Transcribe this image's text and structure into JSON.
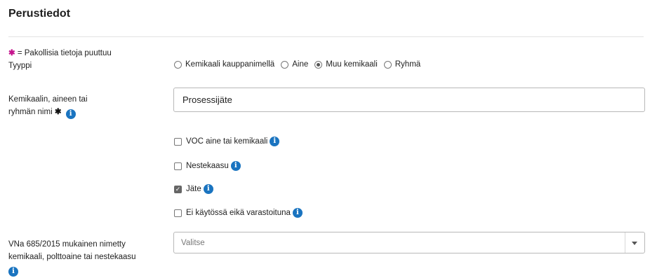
{
  "section": {
    "title": "Perustiedot"
  },
  "required_note": {
    "star": "✱",
    "text": "= Pakollisia tietoja puuttuu"
  },
  "type_field": {
    "label": "Tyyppi",
    "options": [
      {
        "label": "Kemikaali kauppanimellä",
        "selected": false
      },
      {
        "label": "Aine",
        "selected": false
      },
      {
        "label": "Muu kemikaali",
        "selected": true
      },
      {
        "label": "Ryhmä",
        "selected": false
      }
    ]
  },
  "name_field": {
    "label_line1": "Kemikaalin, aineen tai",
    "label_line2": "ryhmän nimi",
    "required_star": "✱",
    "value": "Prosessijäte"
  },
  "checkboxes": [
    {
      "label": "VOC aine tai kemikaali",
      "checked": false
    },
    {
      "label": "Nestekaasu",
      "checked": false
    },
    {
      "label": "Jäte",
      "checked": true
    },
    {
      "label": "Ei käytössä eikä varastoituna",
      "checked": false
    }
  ],
  "vna_field": {
    "label_line1": "VNa 685/2015 mukainen nimetty",
    "label_line2": "kemikaali, polttoaine tai nestekaasu",
    "placeholder": "Valitse"
  },
  "icons": {
    "info": "info-icon",
    "dropdown": "chevron-down-icon"
  },
  "colors": {
    "info_blue": "#1a74c0",
    "required_magenta": "#c4128c"
  }
}
